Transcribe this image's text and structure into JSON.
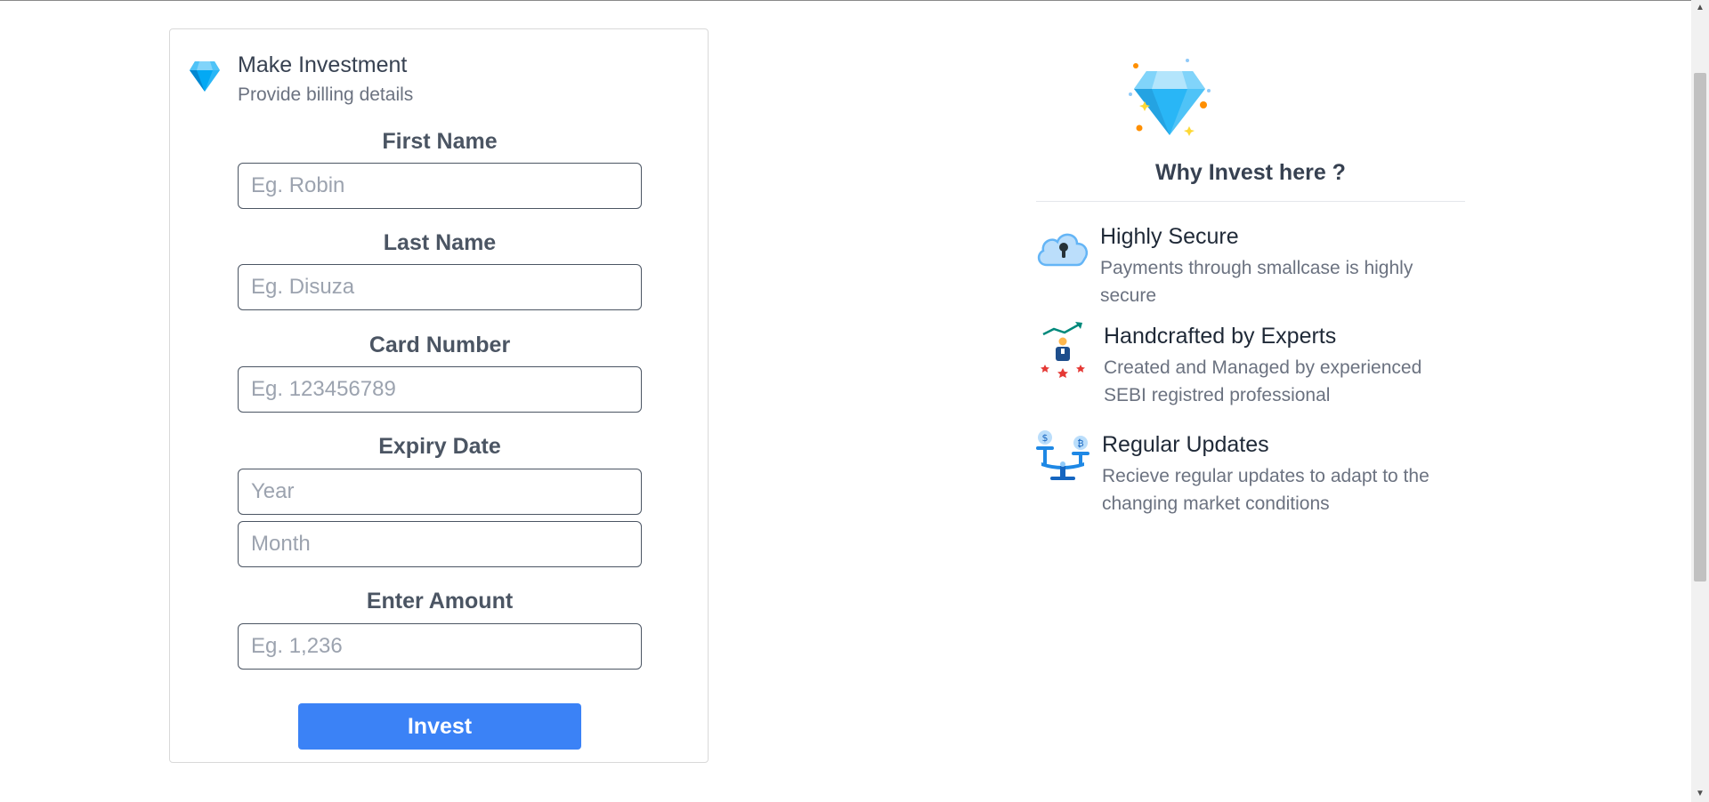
{
  "form": {
    "title": "Make Investment",
    "subtitle": "Provide billing details",
    "header_icon": "diamond-icon",
    "fields": {
      "first_name": {
        "label": "First Name",
        "placeholder": "Eg. Robin",
        "value": ""
      },
      "last_name": {
        "label": "Last Name",
        "placeholder": "Eg. Disuza",
        "value": ""
      },
      "card_number": {
        "label": "Card Number",
        "placeholder": "Eg. 123456789",
        "value": ""
      },
      "expiry": {
        "label": "Expiry Date",
        "year_placeholder": "Year",
        "month_placeholder": "Month"
      },
      "amount": {
        "label": "Enter Amount",
        "placeholder": "Eg. 1,236",
        "value": ""
      }
    },
    "submit_label": "Invest"
  },
  "why": {
    "title": "Why Invest here ?",
    "hero_icon": "diamond-sparkle-icon",
    "features": [
      {
        "icon": "cloud-lock-icon",
        "title": "Highly Secure",
        "description": "Payments through smallcase is highly secure"
      },
      {
        "icon": "expert-growth-icon",
        "title": "Handcrafted by Experts",
        "description": "Created and Managed by experienced SEBI registred professional"
      },
      {
        "icon": "balance-scale-icon",
        "title": "Regular Updates",
        "description": "Recieve regular updates to adapt to the changing market conditions"
      }
    ]
  },
  "colors": {
    "accent": "#3b82f6",
    "diamond": "#4fc3f7",
    "text": "#374151",
    "muted": "#6b7280"
  }
}
